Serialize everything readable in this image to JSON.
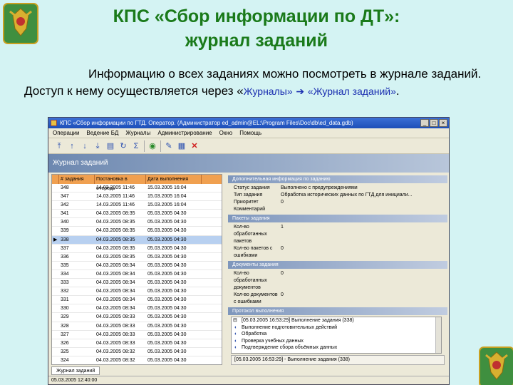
{
  "slide": {
    "title_line1": "КПС «Сбор информации по ДТ»:",
    "title_line2": "журнал заданий",
    "intro_text": "Информацию о всех заданиях можно посмотреть в журнале заданий. Доступ к нему осуществляется через «",
    "intro_link1": "Журналы»",
    "intro_link2": "«Журнал заданий»",
    "intro_end": ".",
    "title_color": "#1a7a1a",
    "link_color": "#1a2eb0"
  },
  "window": {
    "title": "КПС «Сбор информации по ГТД. Оператор. (Администратор ed_admin@EL:\\Program Files\\Doc\\db\\ed_data.gdb)",
    "menu": [
      "Операции",
      "Ведение БД",
      "Журналы",
      "Администрирование",
      "Окно",
      "Помощь"
    ],
    "panel_title": "Журнал заданий",
    "columns": [
      "# задания",
      "Постановка в очередь",
      "Дата выполнения"
    ],
    "rows": [
      [
        "348",
        "14.03.2005 11:46",
        "15.03.2005 16:04"
      ],
      [
        "347",
        "14.03.2005 11:46",
        "15.03.2005 16:04"
      ],
      [
        "342",
        "14.03.2005 11:46",
        "15.03.2005 16:04"
      ],
      [
        "341",
        "04.03.2005 08:35",
        "05.03.2005 04:30"
      ],
      [
        "340",
        "04.03.2005 08:35",
        "05.03.2005 04:30"
      ],
      [
        "339",
        "04.03.2005 08:35",
        "05.03.2005 04:30"
      ],
      [
        "338",
        "04.03.2005 08:35",
        "05.03.2005 04:30"
      ],
      [
        "337",
        "04.03.2005 08:35",
        "05.03.2005 04:30"
      ],
      [
        "336",
        "04.03.2005 08:35",
        "05.03.2005 04:30"
      ],
      [
        "335",
        "04.03.2005 08:34",
        "05.03.2005 04:30"
      ],
      [
        "334",
        "04.03.2005 08:34",
        "05.03.2005 04:30"
      ],
      [
        "333",
        "04.03.2005 08:34",
        "05.03.2005 04:30"
      ],
      [
        "332",
        "04.03.2005 08:34",
        "05.03.2005 04:30"
      ],
      [
        "331",
        "04.03.2005 08:34",
        "05.03.2005 04:30"
      ],
      [
        "330",
        "04.03.2005 08:34",
        "05.03.2005 04:30"
      ],
      [
        "329",
        "04.03.2005 08:33",
        "05.03.2005 04:30"
      ],
      [
        "328",
        "04.03.2005 08:33",
        "05.03.2005 04:30"
      ],
      [
        "327",
        "04.03.2005 08:33",
        "05.03.2005 04:30"
      ],
      [
        "326",
        "04.03.2005 08:33",
        "05.03.2005 04:30"
      ],
      [
        "325",
        "04.03.2005 08:32",
        "05.03.2005 04:30"
      ],
      [
        "324",
        "04.03.2005 08:32",
        "05.03.2005 04:30"
      ]
    ],
    "selected_row": 6,
    "sections": {
      "additional": "Дополнительная информация по заданию",
      "packets": "Пакеты задания",
      "documents": "Документы задания",
      "protocol": "Протокол выполнения"
    },
    "additional_props": [
      {
        "k": "Статус задания",
        "v": "Выполнено с предупреждениями"
      },
      {
        "k": "Тип задания",
        "v": "Обработка исторических данных по ГТД для инициали..."
      },
      {
        "k": "Приоритет",
        "v": "0"
      },
      {
        "k": "Комментарий",
        "v": ""
      }
    ],
    "packet_props": [
      {
        "k": "Кол-во обработанных пакетов",
        "v": "1"
      },
      {
        "k": "Кол-во пакетов с ошибками",
        "v": "0"
      }
    ],
    "document_props": [
      {
        "k": "Кол-во обработанных документов",
        "v": "0"
      },
      {
        "k": "Кол-во документов с ошибками",
        "v": "0"
      }
    ],
    "log": [
      "[05.03.2005 16:53:29] Выполнение задания (338)",
      "Выполнение подготовительных действий",
      "Обработка",
      "Проверка учебных данных",
      "Подтверждение сбора объёмных данных"
    ],
    "status_line": "[05.03.2005 16:53:29] - Выполнение задания (338)",
    "tab_label": "Журнал заданий",
    "statusbar": "05.03.2005 12:40:00"
  }
}
